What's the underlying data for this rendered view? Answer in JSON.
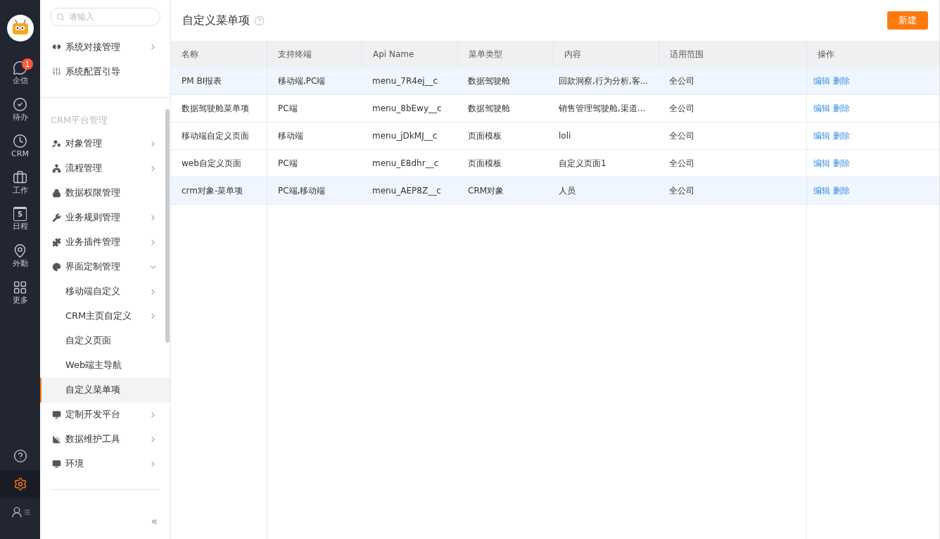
{
  "rail": {
    "top": [
      {
        "label": "企信",
        "badge": "1",
        "selected": false
      },
      {
        "label": "待办",
        "selected": false
      },
      {
        "label": "CRM",
        "selected": false
      },
      {
        "label": "工作",
        "selected": false
      },
      {
        "label": "日程",
        "icon_text": "5",
        "selected": false
      },
      {
        "label": "外勤",
        "selected": false
      },
      {
        "label": "更多",
        "selected": false
      }
    ],
    "bottom": [
      {
        "kind": "help",
        "selected": false
      },
      {
        "kind": "settings",
        "selected": true
      },
      {
        "kind": "contacts",
        "selected": false
      }
    ]
  },
  "sidebar": {
    "search": {
      "placeholder": "请输入"
    },
    "groups": [
      {
        "items": [
          {
            "kind": "branch",
            "label": "系统对接管理",
            "expanded": false,
            "selected": false
          },
          {
            "kind": "leaf",
            "label": "系统配置引导",
            "selected": false
          }
        ]
      },
      {
        "title": "CRM平台管理",
        "items": [
          {
            "kind": "branch",
            "label": "对象管理",
            "expanded": false,
            "selected": false
          },
          {
            "kind": "branch",
            "label": "流程管理",
            "expanded": false,
            "selected": false
          },
          {
            "kind": "leaf",
            "label": "数据权限管理",
            "selected": false
          },
          {
            "kind": "branch",
            "label": "业务规则管理",
            "expanded": false,
            "selected": false
          },
          {
            "kind": "branch",
            "label": "业务插件管理",
            "expanded": false,
            "selected": false
          },
          {
            "kind": "branch",
            "label": "界面定制管理",
            "expanded": true,
            "selected": false,
            "children": [
              {
                "kind": "branch",
                "label": "移动端自定义",
                "expanded": false,
                "selected": false
              },
              {
                "kind": "branch",
                "label": "CRM主页自定义",
                "expanded": false,
                "selected": false
              },
              {
                "kind": "leaf",
                "label": "自定义页面",
                "selected": false
              },
              {
                "kind": "leaf",
                "label": "Web端主导航",
                "selected": false
              },
              {
                "kind": "leaf",
                "label": "自定义菜单项",
                "selected": true
              }
            ]
          },
          {
            "kind": "branch",
            "label": "定制开发平台",
            "expanded": false,
            "selected": false
          },
          {
            "kind": "branch",
            "label": "数据维护工具",
            "expanded": false,
            "selected": false
          },
          {
            "kind": "branch",
            "label": "环境",
            "expanded": false,
            "selected": false
          }
        ]
      }
    ],
    "collapse": "«"
  },
  "page": {
    "title": "自定义菜单项",
    "new_button": "新建"
  },
  "table": {
    "columns": [
      "名称",
      "支持终端",
      "Api Name",
      "菜单类型",
      "内容",
      "适用范围",
      "操作"
    ],
    "rows": [
      {
        "cells": [
          "PM BI报表",
          "移动端,PC端",
          "menu_7R4ej__c",
          "数据驾驶舱",
          "回款洞察,行为分析,客...",
          "全公司"
        ],
        "actions": [
          "编辑",
          "删除"
        ],
        "highlighted": true
      },
      {
        "cells": [
          "数据驾驶舱菜单项",
          "PC端",
          "menu_8bEwy__c",
          "数据驾驶舱",
          "销售管理驾驶舱,渠道...",
          "全公司"
        ],
        "actions": [
          "编辑",
          "删除"
        ],
        "highlighted": false
      },
      {
        "cells": [
          "移动端自定义页面",
          "移动端",
          "menu_jDkMJ__c",
          "页面模板",
          "loli",
          "全公司"
        ],
        "actions": [
          "编辑",
          "删除"
        ],
        "highlighted": false
      },
      {
        "cells": [
          "web自定义页面",
          "PC端",
          "menu_E8dhr__c",
          "页面模板",
          "自定义页面1",
          "全公司"
        ],
        "actions": [
          "编辑",
          "删除"
        ],
        "highlighted": false
      },
      {
        "cells": [
          "crm对象-菜单项",
          "PC端,移动端",
          "menu_AEP8Z__c",
          "CRM对象",
          "人员",
          "全公司"
        ],
        "actions": [
          "编辑",
          "删除"
        ],
        "highlighted": true
      }
    ]
  }
}
